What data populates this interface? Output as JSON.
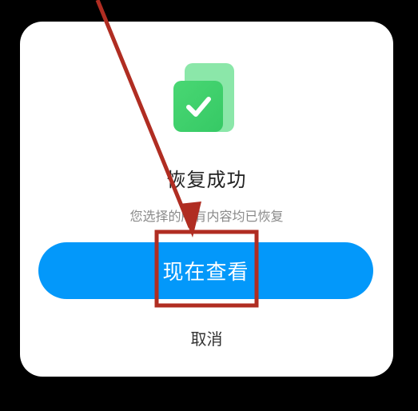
{
  "dialog": {
    "title": "恢复成功",
    "subtitle": "您选择的所有内容均已恢复",
    "primary_button_label": "现在查看",
    "cancel_label": "取消",
    "icon": "check-document-icon"
  },
  "colors": {
    "backdrop": "#000000",
    "primary": "#0398fa",
    "icon_green": "#45d36f",
    "annotation_red": "#b02d22"
  }
}
